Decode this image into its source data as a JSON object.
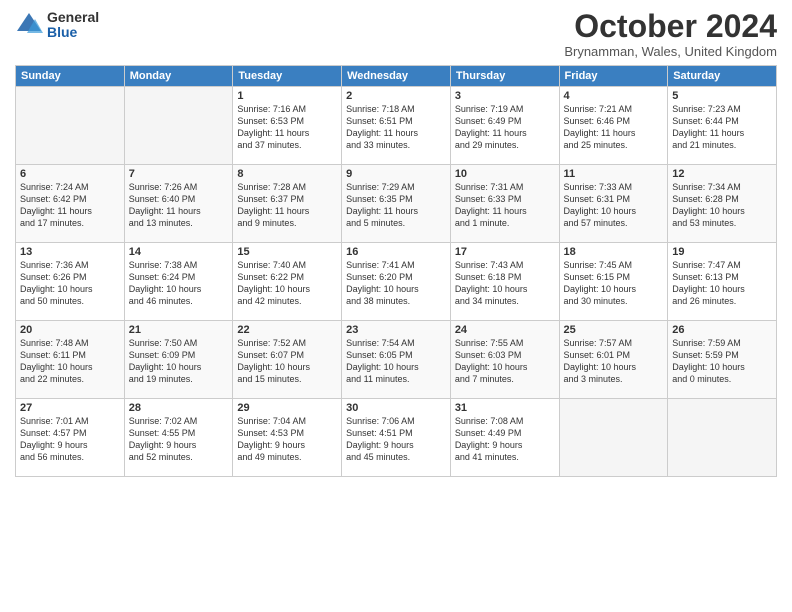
{
  "logo": {
    "general": "General",
    "blue": "Blue"
  },
  "title": "October 2024",
  "location": "Brynamman, Wales, United Kingdom",
  "days_of_week": [
    "Sunday",
    "Monday",
    "Tuesday",
    "Wednesday",
    "Thursday",
    "Friday",
    "Saturday"
  ],
  "weeks": [
    [
      {
        "day": "",
        "content": ""
      },
      {
        "day": "",
        "content": ""
      },
      {
        "day": "1",
        "content": "Sunrise: 7:16 AM\nSunset: 6:53 PM\nDaylight: 11 hours\nand 37 minutes."
      },
      {
        "day": "2",
        "content": "Sunrise: 7:18 AM\nSunset: 6:51 PM\nDaylight: 11 hours\nand 33 minutes."
      },
      {
        "day": "3",
        "content": "Sunrise: 7:19 AM\nSunset: 6:49 PM\nDaylight: 11 hours\nand 29 minutes."
      },
      {
        "day": "4",
        "content": "Sunrise: 7:21 AM\nSunset: 6:46 PM\nDaylight: 11 hours\nand 25 minutes."
      },
      {
        "day": "5",
        "content": "Sunrise: 7:23 AM\nSunset: 6:44 PM\nDaylight: 11 hours\nand 21 minutes."
      }
    ],
    [
      {
        "day": "6",
        "content": "Sunrise: 7:24 AM\nSunset: 6:42 PM\nDaylight: 11 hours\nand 17 minutes."
      },
      {
        "day": "7",
        "content": "Sunrise: 7:26 AM\nSunset: 6:40 PM\nDaylight: 11 hours\nand 13 minutes."
      },
      {
        "day": "8",
        "content": "Sunrise: 7:28 AM\nSunset: 6:37 PM\nDaylight: 11 hours\nand 9 minutes."
      },
      {
        "day": "9",
        "content": "Sunrise: 7:29 AM\nSunset: 6:35 PM\nDaylight: 11 hours\nand 5 minutes."
      },
      {
        "day": "10",
        "content": "Sunrise: 7:31 AM\nSunset: 6:33 PM\nDaylight: 11 hours\nand 1 minute."
      },
      {
        "day": "11",
        "content": "Sunrise: 7:33 AM\nSunset: 6:31 PM\nDaylight: 10 hours\nand 57 minutes."
      },
      {
        "day": "12",
        "content": "Sunrise: 7:34 AM\nSunset: 6:28 PM\nDaylight: 10 hours\nand 53 minutes."
      }
    ],
    [
      {
        "day": "13",
        "content": "Sunrise: 7:36 AM\nSunset: 6:26 PM\nDaylight: 10 hours\nand 50 minutes."
      },
      {
        "day": "14",
        "content": "Sunrise: 7:38 AM\nSunset: 6:24 PM\nDaylight: 10 hours\nand 46 minutes."
      },
      {
        "day": "15",
        "content": "Sunrise: 7:40 AM\nSunset: 6:22 PM\nDaylight: 10 hours\nand 42 minutes."
      },
      {
        "day": "16",
        "content": "Sunrise: 7:41 AM\nSunset: 6:20 PM\nDaylight: 10 hours\nand 38 minutes."
      },
      {
        "day": "17",
        "content": "Sunrise: 7:43 AM\nSunset: 6:18 PM\nDaylight: 10 hours\nand 34 minutes."
      },
      {
        "day": "18",
        "content": "Sunrise: 7:45 AM\nSunset: 6:15 PM\nDaylight: 10 hours\nand 30 minutes."
      },
      {
        "day": "19",
        "content": "Sunrise: 7:47 AM\nSunset: 6:13 PM\nDaylight: 10 hours\nand 26 minutes."
      }
    ],
    [
      {
        "day": "20",
        "content": "Sunrise: 7:48 AM\nSunset: 6:11 PM\nDaylight: 10 hours\nand 22 minutes."
      },
      {
        "day": "21",
        "content": "Sunrise: 7:50 AM\nSunset: 6:09 PM\nDaylight: 10 hours\nand 19 minutes."
      },
      {
        "day": "22",
        "content": "Sunrise: 7:52 AM\nSunset: 6:07 PM\nDaylight: 10 hours\nand 15 minutes."
      },
      {
        "day": "23",
        "content": "Sunrise: 7:54 AM\nSunset: 6:05 PM\nDaylight: 10 hours\nand 11 minutes."
      },
      {
        "day": "24",
        "content": "Sunrise: 7:55 AM\nSunset: 6:03 PM\nDaylight: 10 hours\nand 7 minutes."
      },
      {
        "day": "25",
        "content": "Sunrise: 7:57 AM\nSunset: 6:01 PM\nDaylight: 10 hours\nand 3 minutes."
      },
      {
        "day": "26",
        "content": "Sunrise: 7:59 AM\nSunset: 5:59 PM\nDaylight: 10 hours\nand 0 minutes."
      }
    ],
    [
      {
        "day": "27",
        "content": "Sunrise: 7:01 AM\nSunset: 4:57 PM\nDaylight: 9 hours\nand 56 minutes."
      },
      {
        "day": "28",
        "content": "Sunrise: 7:02 AM\nSunset: 4:55 PM\nDaylight: 9 hours\nand 52 minutes."
      },
      {
        "day": "29",
        "content": "Sunrise: 7:04 AM\nSunset: 4:53 PM\nDaylight: 9 hours\nand 49 minutes."
      },
      {
        "day": "30",
        "content": "Sunrise: 7:06 AM\nSunset: 4:51 PM\nDaylight: 9 hours\nand 45 minutes."
      },
      {
        "day": "31",
        "content": "Sunrise: 7:08 AM\nSunset: 4:49 PM\nDaylight: 9 hours\nand 41 minutes."
      },
      {
        "day": "",
        "content": ""
      },
      {
        "day": "",
        "content": ""
      }
    ]
  ]
}
